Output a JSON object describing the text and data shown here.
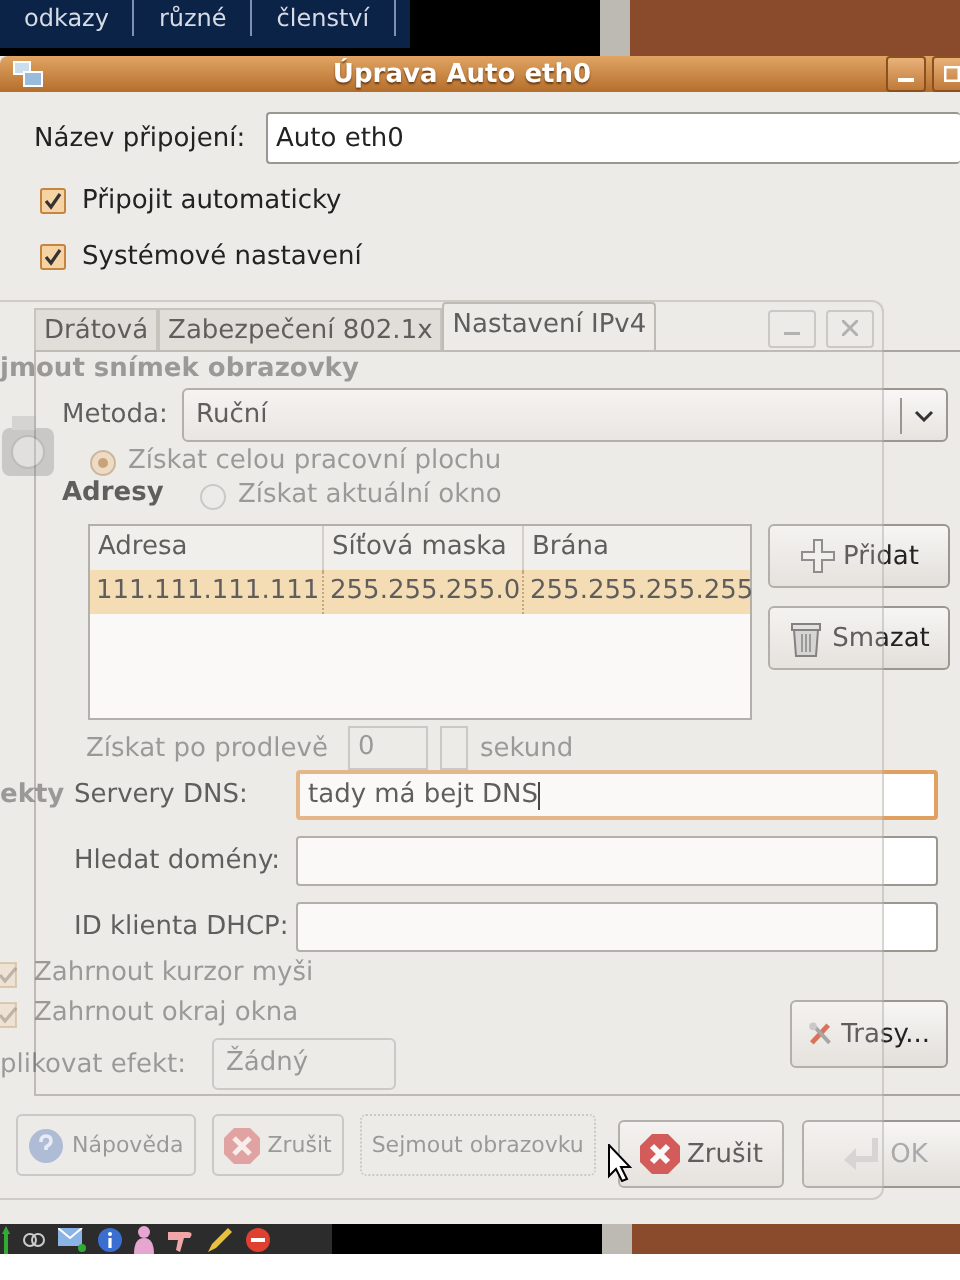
{
  "desktop_tabs": [
    "odkazy",
    "různé",
    "členství"
  ],
  "window": {
    "title": "Úprava Auto eth0"
  },
  "connection_name": {
    "label": "Název připojení:",
    "value": "Auto eth0"
  },
  "options": [
    {
      "label": "Připojit automaticky",
      "checked": true
    },
    {
      "label": "Systémové nastavení",
      "checked": true
    }
  ],
  "tabs": [
    {
      "label": "Drátová",
      "selected": false
    },
    {
      "label": "Zabezpečení 802.1x",
      "selected": false
    },
    {
      "label": "Nastavení IPv4",
      "selected": true
    }
  ],
  "ipv4": {
    "method": {
      "label": "Metoda:",
      "value": "Ruční"
    },
    "addresses_heading": "Adresy",
    "table": {
      "columns": [
        "Adresa",
        "Síťová maska",
        "Brána"
      ],
      "rows": [
        {
          "cells": [
            "111.111.111.111",
            "255.255.255.0",
            "255.255.255.255"
          ],
          "selected": true
        }
      ]
    },
    "buttons": [
      {
        "label": "Přidat",
        "kind": "add"
      },
      {
        "label": "Smazat",
        "kind": "delete"
      }
    ],
    "fields": [
      {
        "label": "Servery DNS:",
        "value": "tady má bejt DNS",
        "focused": true
      },
      {
        "label": "Hledat domény:",
        "focused": false
      },
      {
        "label": "ID klienta DHCP:",
        "focused": false
      }
    ],
    "routes_button": "Trasy..."
  },
  "dialog_buttons": [
    {
      "label": "Zrušit",
      "kind": "cancel",
      "disabled": false
    },
    {
      "label": "OK",
      "kind": "ok",
      "disabled": true
    }
  ],
  "screenshot_dialog": {
    "title": "jmout snímek obrazovky",
    "options": [
      {
        "label": "Získat celou pracovní plochu",
        "selected": true
      },
      {
        "label": "Získat aktuální okno",
        "selected": false
      }
    ],
    "delay": {
      "label": "Získat po prodlevě",
      "value": "0",
      "unit": "sekund"
    },
    "effects_heading": "ekty",
    "effects": [
      {
        "label": "Zahrnout kurzor myši",
        "checked": true
      },
      {
        "label": "Zahrnout okraj okna",
        "checked": true
      }
    ],
    "apply_effect": {
      "label": "plikovat efekt:",
      "value": "Žádný"
    },
    "buttons": [
      {
        "label": "Nápověda",
        "kind": "help"
      },
      {
        "label": "Zrušit",
        "kind": "cancel"
      },
      {
        "label": "Sejmout obrazovku",
        "kind": "capture"
      }
    ]
  }
}
